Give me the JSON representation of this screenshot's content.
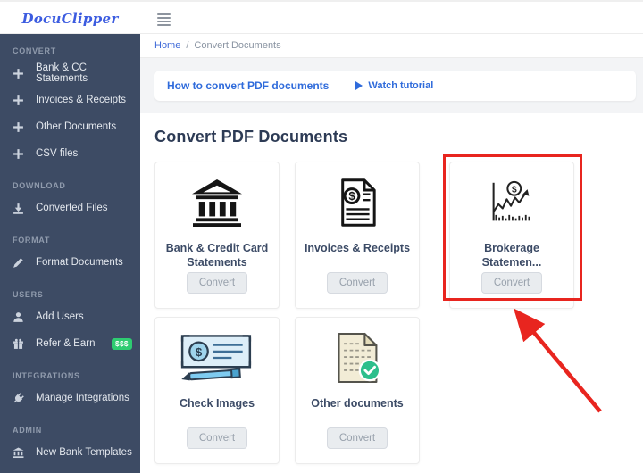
{
  "header": {
    "logo_text": "DocuClipper",
    "menu_icon": "hamburger-menu-icon"
  },
  "breadcrumb": {
    "home": "Home",
    "separator": "/",
    "current": "Convert Documents"
  },
  "banner": {
    "title": "How to convert PDF documents",
    "play_icon": "play-icon",
    "link_label": "Watch tutorial"
  },
  "page": {
    "heading": "Convert PDF Documents"
  },
  "sidebar": {
    "sections": [
      {
        "label": "CONVERT",
        "items": [
          {
            "icon": "plus-icon",
            "label": "Bank & CC Statements"
          },
          {
            "icon": "plus-icon",
            "label": "Invoices & Receipts"
          },
          {
            "icon": "plus-icon",
            "label": "Other Documents"
          },
          {
            "icon": "plus-icon",
            "label": "CSV files"
          }
        ]
      },
      {
        "label": "DOWNLOAD",
        "items": [
          {
            "icon": "download-icon",
            "label": "Converted Files"
          }
        ]
      },
      {
        "label": "FORMAT",
        "items": [
          {
            "icon": "pencil-icon",
            "label": "Format Documents"
          }
        ]
      },
      {
        "label": "USERS",
        "items": [
          {
            "icon": "user-icon",
            "label": "Add Users"
          },
          {
            "icon": "gift-icon",
            "label": "Refer & Earn",
            "badge": "$$$"
          }
        ]
      },
      {
        "label": "INTEGRATIONS",
        "items": [
          {
            "icon": "plug-icon",
            "label": "Manage Integrations"
          }
        ]
      },
      {
        "label": "ADMIN",
        "items": [
          {
            "icon": "bank-small-icon",
            "label": "New Bank Templates"
          }
        ]
      }
    ]
  },
  "cards": [
    {
      "icon": "bank-icon",
      "title": "Bank & Credit Card Statements",
      "button_label": "Convert",
      "highlighted": false
    },
    {
      "icon": "invoice-icon",
      "title": "Invoices & Receipts",
      "button_label": "Convert",
      "highlighted": false
    },
    {
      "icon": "brokerage-chart-icon",
      "title": "Brokerage Statemen...",
      "button_label": "Convert",
      "highlighted": true
    },
    {
      "icon": "check-image-icon",
      "title": "Check Images",
      "button_label": "Convert",
      "highlighted": false
    },
    {
      "icon": "other-document-icon",
      "title": "Other documents",
      "button_label": "Convert",
      "highlighted": false
    }
  ],
  "annotation": {
    "shape": "red-box-and-arrow",
    "color": "#e8251f"
  },
  "colors": {
    "sidebar_bg": "#3d4b64",
    "accent_blue": "#2f6bdb",
    "logo_blue": "#3c5ce0",
    "badge_green": "#2ecc71",
    "annotation_red": "#e8251f",
    "check_green": "#2dbf8c"
  }
}
